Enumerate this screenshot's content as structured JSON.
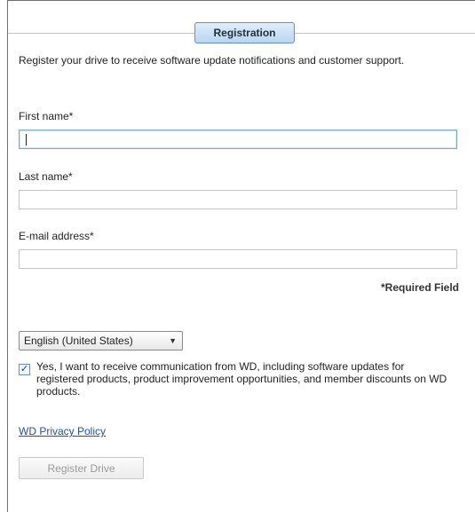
{
  "header": {
    "tab_label": "Registration"
  },
  "intro_text": "Register your drive to receive software update notifications and customer support.",
  "form": {
    "first_name": {
      "label": "First name*",
      "value": ""
    },
    "last_name": {
      "label": "Last name*",
      "value": ""
    },
    "email": {
      "label": "E-mail address*",
      "value": ""
    },
    "required_note": "*Required Field"
  },
  "language": {
    "selected": "English (United States)",
    "icon": "chevron-down-icon"
  },
  "consent": {
    "checked": true,
    "text": "Yes, I want to receive communication from WD, including software updates for registered products, product improvement opportunities, and member discounts on WD products."
  },
  "privacy_link": "WD Privacy Policy",
  "register_button": {
    "label": "Register Drive",
    "enabled": false
  },
  "colors": {
    "link": "#1f4fb5",
    "tab_bg": "#b9d5f0",
    "focus_border": "#7aa8d6"
  }
}
